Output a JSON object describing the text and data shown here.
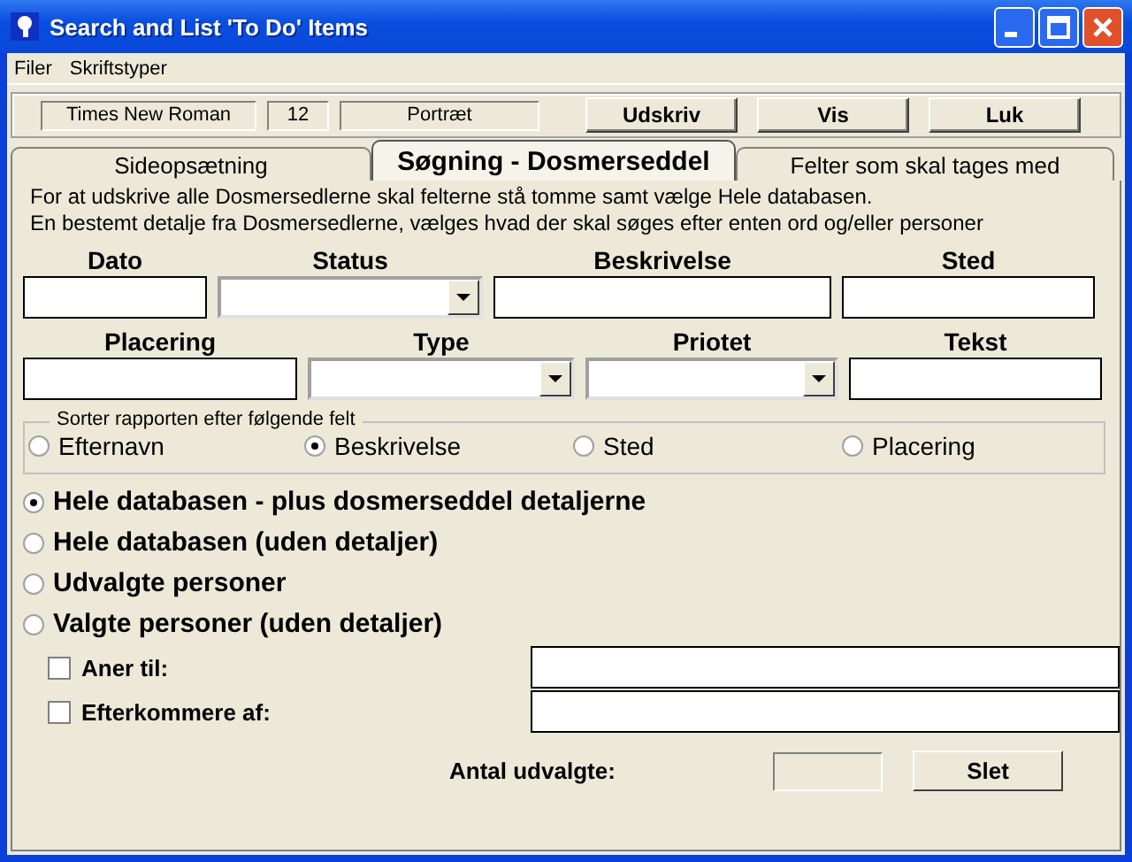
{
  "window": {
    "title": "Search and List 'To Do' Items"
  },
  "menu": [
    "Filer",
    "Skriftstyper"
  ],
  "toolbar": {
    "font": "Times New Roman",
    "size": "12",
    "orientation": "Portræt",
    "buttons": [
      "Udskriv",
      "Vis",
      "Luk"
    ]
  },
  "tabs": [
    {
      "label": "Sideopsætning",
      "selected": false
    },
    {
      "label": "Søgning - Dosmerseddel",
      "selected": true
    },
    {
      "label": "Felter som skal tages med",
      "selected": false
    }
  ],
  "intro": [
    "For at udskrive alle Dosmersedlerne skal felterne stå tomme samt vælge Hele databasen.",
    "En bestemt detalje fra Dosmersedlerne, vælges hvad der skal søges efter enten ord og/eller personer"
  ],
  "field_rows": [
    [
      {
        "label": "Dato",
        "kind": "text"
      },
      {
        "label": "Status",
        "kind": "combo"
      },
      {
        "label": "Beskrivelse",
        "kind": "text"
      },
      {
        "label": "Sted",
        "kind": "text"
      }
    ],
    [
      {
        "label": "Placering",
        "kind": "text"
      },
      {
        "label": "Type",
        "kind": "combo"
      },
      {
        "label": "Priotet",
        "kind": "combo"
      },
      {
        "label": "Tekst",
        "kind": "text"
      }
    ]
  ],
  "sort": {
    "title": "Sorter rapporten efter følgende felt",
    "options": [
      {
        "label": "Efternavn",
        "selected": false
      },
      {
        "label": "Beskrivelse",
        "selected": true
      },
      {
        "label": "Sted",
        "selected": false
      },
      {
        "label": "Placering",
        "selected": false
      }
    ]
  },
  "scope": [
    {
      "label": "Hele databasen - plus dosmerseddel detaljerne",
      "selected": true
    },
    {
      "label": "Hele databasen (uden detaljer)",
      "selected": false
    },
    {
      "label": "Udvalgte personer",
      "selected": false
    },
    {
      "label": "Valgte personer (uden detaljer)",
      "selected": false
    }
  ],
  "filters": [
    {
      "label": "Aner til:",
      "checked": false
    },
    {
      "label": "Efterkommere af:",
      "checked": false
    }
  ],
  "count": {
    "label": "Antal udvalgte:"
  },
  "delete_button": "Slet"
}
